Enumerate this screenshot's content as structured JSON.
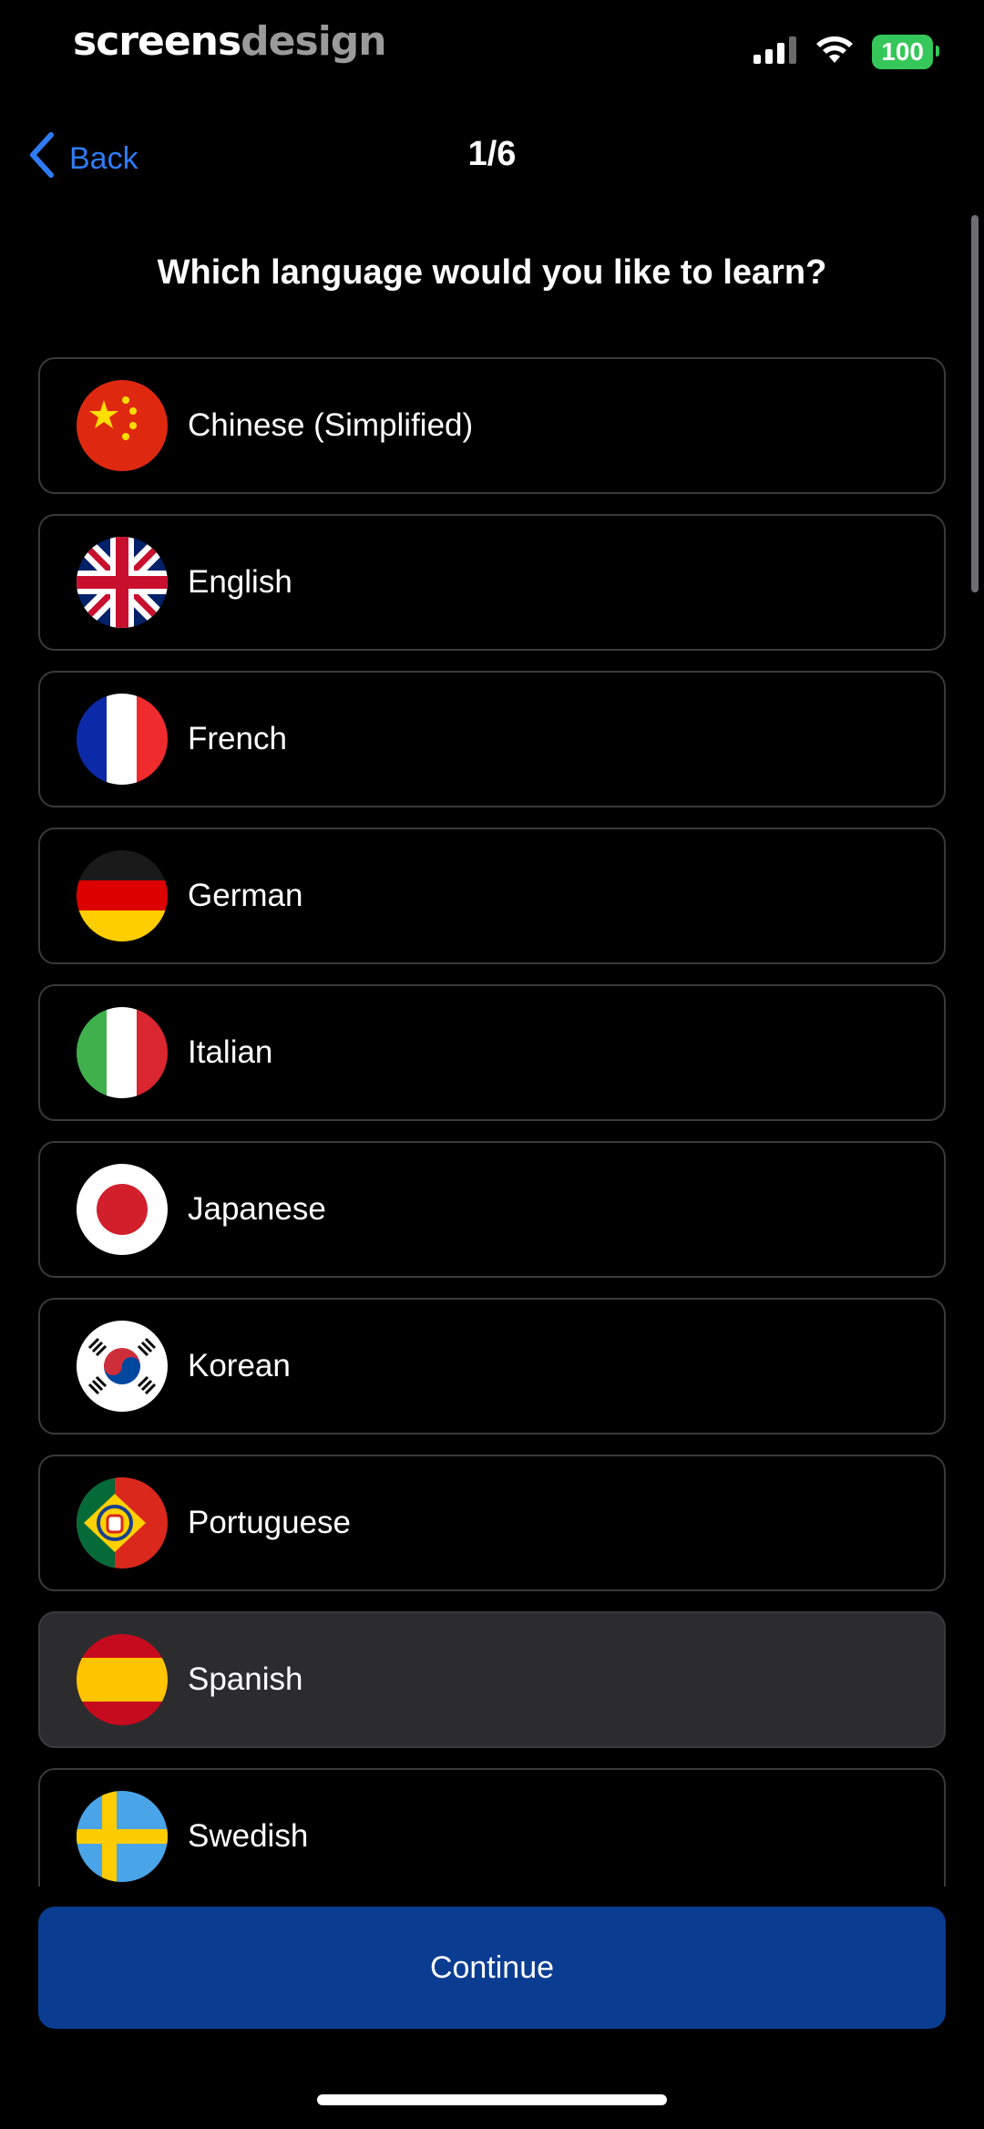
{
  "status": {
    "brand_primary": "screens",
    "brand_secondary": "design",
    "battery": "100",
    "icons": [
      "signal-icon",
      "wifi-icon",
      "battery-icon"
    ]
  },
  "nav": {
    "back_label": "Back",
    "step": "1/6"
  },
  "question": "Which language would you like to learn?",
  "languages": [
    {
      "label": "Chinese (Simplified)",
      "flag": "china-flag-icon"
    },
    {
      "label": "English",
      "flag": "uk-flag-icon"
    },
    {
      "label": "French",
      "flag": "france-flag-icon"
    },
    {
      "label": "German",
      "flag": "germany-flag-icon"
    },
    {
      "label": "Italian",
      "flag": "italy-flag-icon"
    },
    {
      "label": "Japanese",
      "flag": "japan-flag-icon"
    },
    {
      "label": "Korean",
      "flag": "korea-flag-icon"
    },
    {
      "label": "Portuguese",
      "flag": "portugal-flag-icon"
    },
    {
      "label": "Spanish",
      "flag": "spain-flag-icon",
      "selected": true
    },
    {
      "label": "Swedish",
      "flag": "sweden-flag-icon"
    }
  ],
  "continue_label": "Continue",
  "colors": {
    "accent": "#2f7bf5",
    "button": "#0a3d91",
    "selected_row": "#2c2c2e",
    "battery": "#35c759"
  }
}
